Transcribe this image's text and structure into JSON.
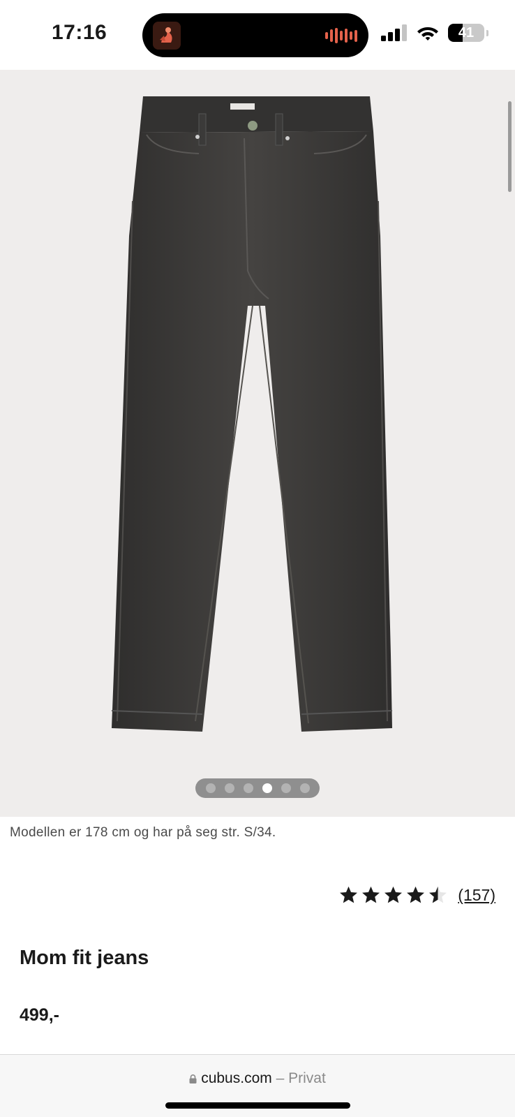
{
  "status_bar": {
    "time": "17:16",
    "battery": "41",
    "battery_level": 0.41,
    "icons": [
      "signal-icon",
      "wifi-icon",
      "battery-icon"
    ]
  },
  "gallery": {
    "image_alt_icon": "jeans-product-image",
    "dots": [
      {
        "active": false
      },
      {
        "active": false
      },
      {
        "active": false
      },
      {
        "active": true
      },
      {
        "active": false
      },
      {
        "active": false
      }
    ]
  },
  "product": {
    "model_note": "Modellen er 178 cm og har på seg str. S/34.",
    "rating_value": 4.5,
    "rating_max": 5,
    "rating_count": "(157)",
    "title": "Mom fit jeans",
    "price": "499,-"
  },
  "browser": {
    "domain": "cubus.com",
    "separator": " – ",
    "mode": "Privat"
  },
  "colors": {
    "image_bg": "#efedec",
    "denim": "#3a3938",
    "text": "#1a1a1a",
    "island_wave": "#e5624b"
  }
}
